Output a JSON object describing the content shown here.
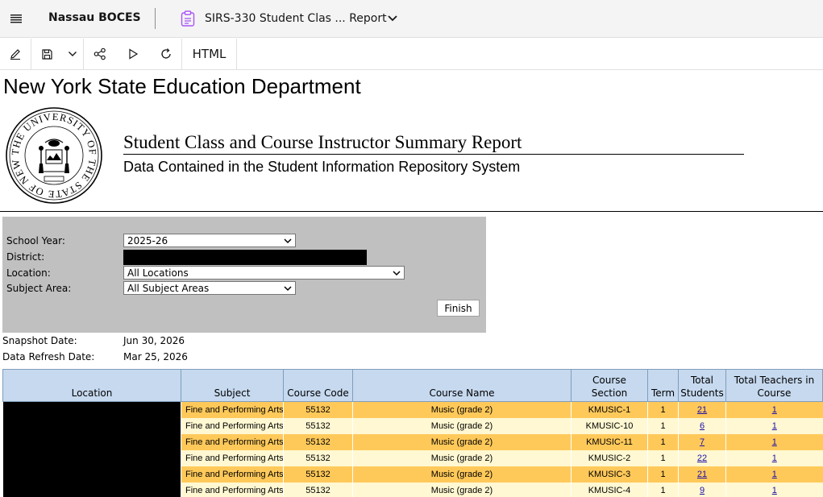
{
  "appbar": {
    "brand": "Nassau BOCES",
    "report_title": "SIRS-330 Student Clas ... Report"
  },
  "toolbar": {
    "html_label": "HTML"
  },
  "report": {
    "heading": "New York State Education Department",
    "title": "Student Class and Course Instructor Summary Report",
    "subtitle": "Data Contained in the Student Information Repository System",
    "seal_text": "THE UNIVERSITY OF THE STATE OF NEW YORK"
  },
  "prompts": {
    "school_year_label": "School Year:",
    "school_year_value": "2025-26",
    "district_label": "District:",
    "location_label": "Location:",
    "location_value": "All Locations",
    "subject_label": "Subject Area:",
    "subject_value": "All Subject Areas",
    "finish_label": "Finish"
  },
  "meta": {
    "snapshot_label": "Snapshot Date:",
    "snapshot_value": "Jun 30, 2026",
    "refresh_label": "Data Refresh Date:",
    "refresh_value": "Mar 25, 2026"
  },
  "table": {
    "headers": [
      "Location",
      "Subject",
      "Course Code",
      "Course Name",
      "Course Section",
      "Term",
      "Total Students",
      "Total Teachers in Course"
    ],
    "rows": [
      {
        "subject": "Fine and Performing Arts",
        "code": "55132",
        "name": "Music (grade 2)",
        "section": "KMUSIC-1",
        "term": "1",
        "students": "21",
        "teachers": "1"
      },
      {
        "subject": "Fine and Performing Arts",
        "code": "55132",
        "name": "Music (grade 2)",
        "section": "KMUSIC-10",
        "term": "1",
        "students": "6",
        "teachers": "1"
      },
      {
        "subject": "Fine and Performing Arts",
        "code": "55132",
        "name": "Music (grade 2)",
        "section": "KMUSIC-11",
        "term": "1",
        "students": "7",
        "teachers": "1"
      },
      {
        "subject": "Fine and Performing Arts",
        "code": "55132",
        "name": "Music (grade 2)",
        "section": "KMUSIC-2",
        "term": "1",
        "students": "22",
        "teachers": "1"
      },
      {
        "subject": "Fine and Performing Arts",
        "code": "55132",
        "name": "Music (grade 2)",
        "section": "KMUSIC-3",
        "term": "1",
        "students": "21",
        "teachers": "1"
      },
      {
        "subject": "Fine and Performing Arts",
        "code": "55132",
        "name": "Music (grade 2)",
        "section": "KMUSIC-4",
        "term": "1",
        "students": "9",
        "teachers": "1"
      }
    ]
  },
  "colors": {
    "header_bg": "#c6d9ef",
    "row_odd": "#ffc95a",
    "row_even": "#fff8d2",
    "panel_bg": "#c0c0c0",
    "icon_accent": "#a855f7"
  },
  "icons": {
    "menu": "hamburger-icon",
    "report": "report-clipboard-icon",
    "caret": "chevron-down-icon",
    "edit": "pencil-icon",
    "save": "save-icon",
    "share": "share-icon",
    "run": "play-icon",
    "refresh": "refresh-icon"
  }
}
